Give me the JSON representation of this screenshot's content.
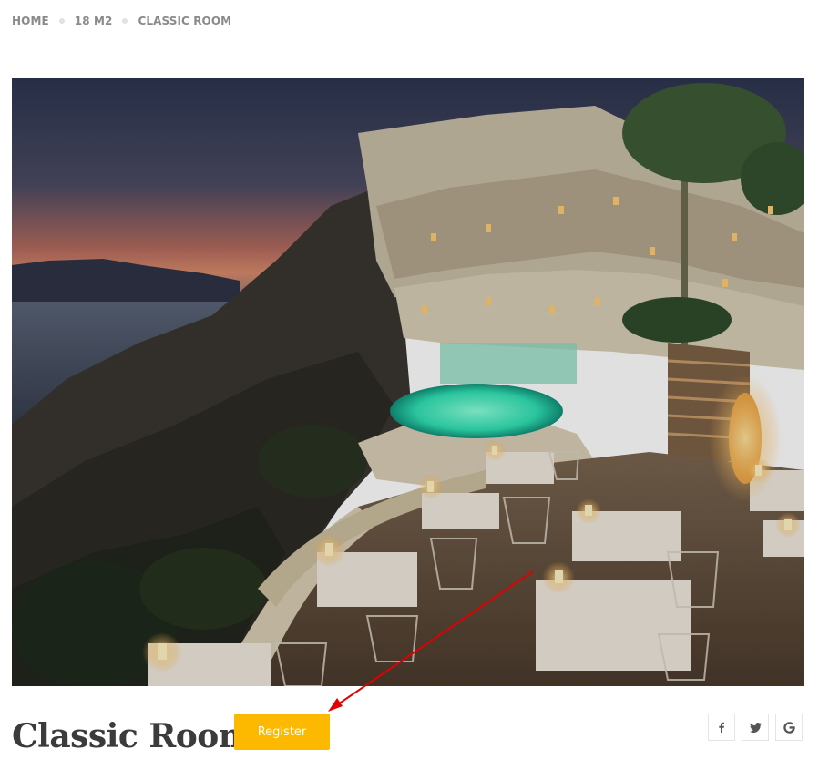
{
  "breadcrumb": {
    "items": [
      "HOME",
      "18 M2",
      "CLASSIC ROOM"
    ]
  },
  "room": {
    "title": "Classic Room",
    "register_label": "Register"
  },
  "social": {
    "icons": [
      "facebook-icon",
      "twitter-icon",
      "google-icon"
    ]
  },
  "colors": {
    "accent": "#fcb900",
    "title": "#3b3b3b",
    "breadcrumb": "#8a8a8a",
    "annotation_arrow": "#e00000"
  }
}
